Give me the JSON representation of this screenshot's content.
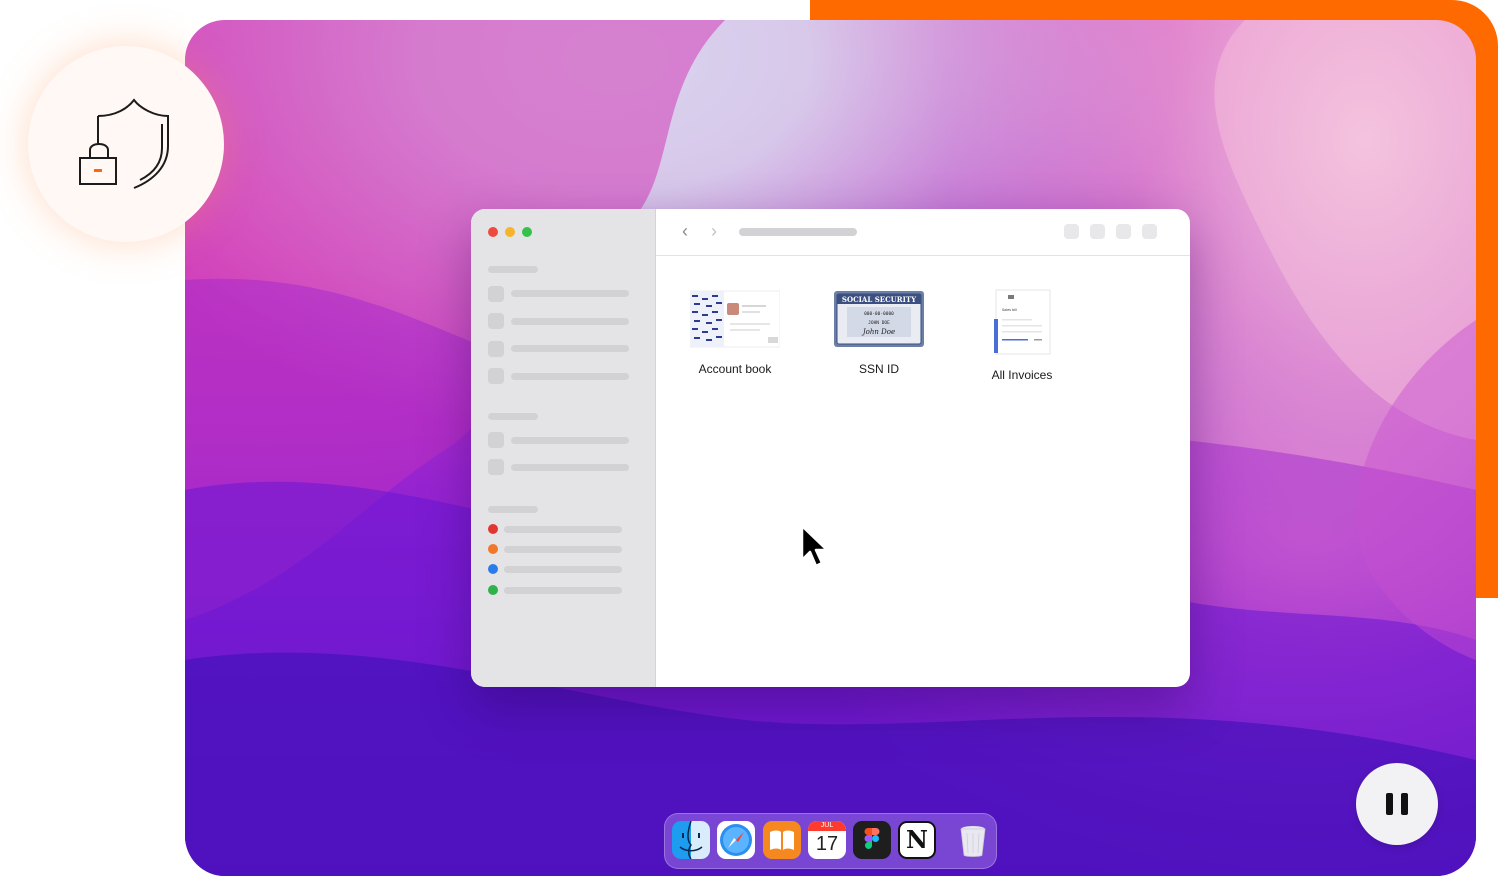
{
  "window": {
    "files": [
      {
        "label": "Account book"
      },
      {
        "label": "SSN ID"
      },
      {
        "label": "All Invoices"
      }
    ],
    "ssn_card": {
      "header": "SOCIAL SECURITY",
      "number": "000-00-0000",
      "name": "JOHN DOE",
      "signature": "John Doe"
    },
    "invoice_thumb_title": "Sales bill"
  },
  "dock": {
    "apps": [
      "Finder",
      "Safari",
      "Books",
      "Calendar",
      "Figma",
      "Notion",
      "Trash"
    ],
    "calendar_month": "JUL",
    "calendar_day": "17",
    "notion_glyph": "N"
  },
  "sidebar": {
    "tag_colors": [
      "#e0382e",
      "#f0782a",
      "#2a7de8",
      "#2fb24a"
    ]
  },
  "colors": {
    "accent": "#ff6a00"
  },
  "icons": {
    "badge": "shield-lock-icon",
    "control": "pause-icon"
  }
}
